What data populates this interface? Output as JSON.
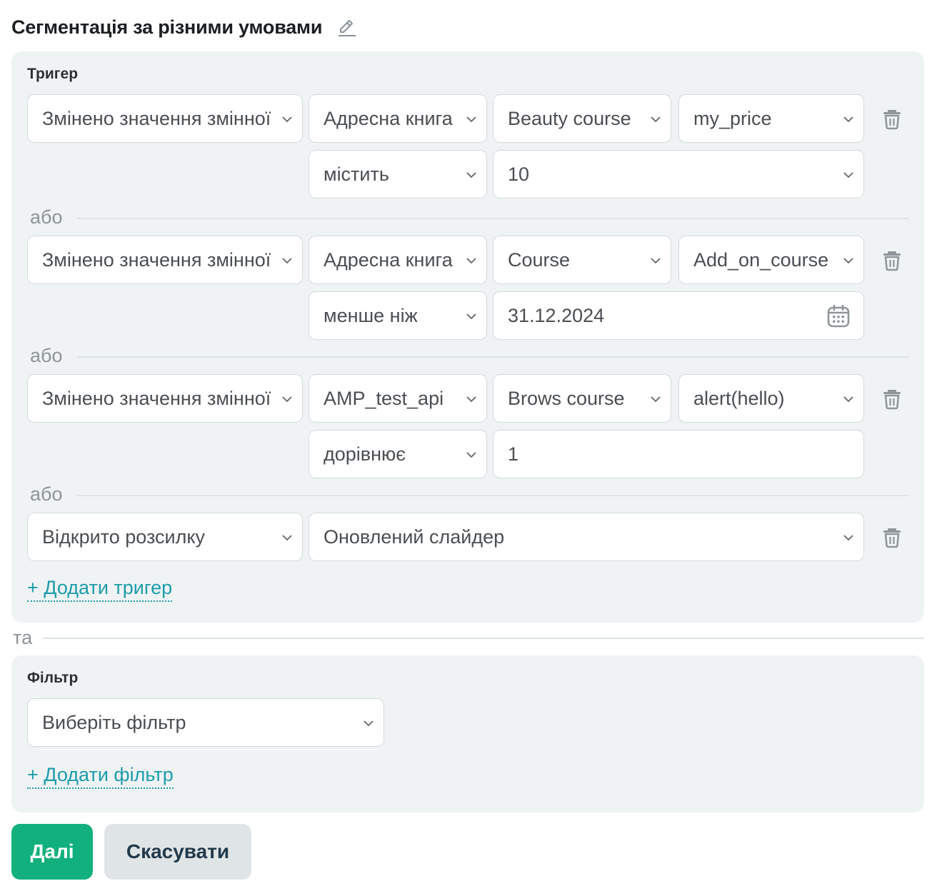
{
  "header": {
    "title": "Сегментація за різними умовами",
    "edit_icon": "pencil-icon"
  },
  "trigger_section": {
    "label": "Тригер",
    "separator": "або",
    "triggers": [
      {
        "type": "Змінено значення змінної",
        "source": "Адресна книга",
        "book": "Beauty course",
        "variable": "my_price",
        "operator": "містить",
        "value": "10"
      },
      {
        "type": "Змінено значення змінної",
        "source": "Адресна книга",
        "book": "Course",
        "variable": "Add_on_course",
        "operator": "менше ніж",
        "value": "31.12.2024"
      },
      {
        "type": "Змінено значення змінної",
        "source": "AMP_test_api",
        "book": "Brows course",
        "variable": "alert(hello)",
        "operator": "дорівнює",
        "value": "1"
      },
      {
        "type": "Відкрито розсилку",
        "campaign": "Оновлений слайдер"
      }
    ],
    "add_trigger": "+ Додати тригер"
  },
  "and_separator": "та",
  "filter_section": {
    "label": "Фільтр",
    "filter_placeholder": "Виберіть фільтр",
    "add_filter": "+ Додати фільтр"
  },
  "actions": {
    "next": "Далі",
    "cancel": "Скасувати"
  },
  "colors": {
    "panel_bg": "#f0f3f4",
    "link": "#1c9cab",
    "primary_button": "#12b07c",
    "secondary_button": "#dfe5e7"
  },
  "icons": {
    "dropdown": "chevron-down-icon",
    "delete": "trash-icon",
    "date": "calendar-icon"
  }
}
